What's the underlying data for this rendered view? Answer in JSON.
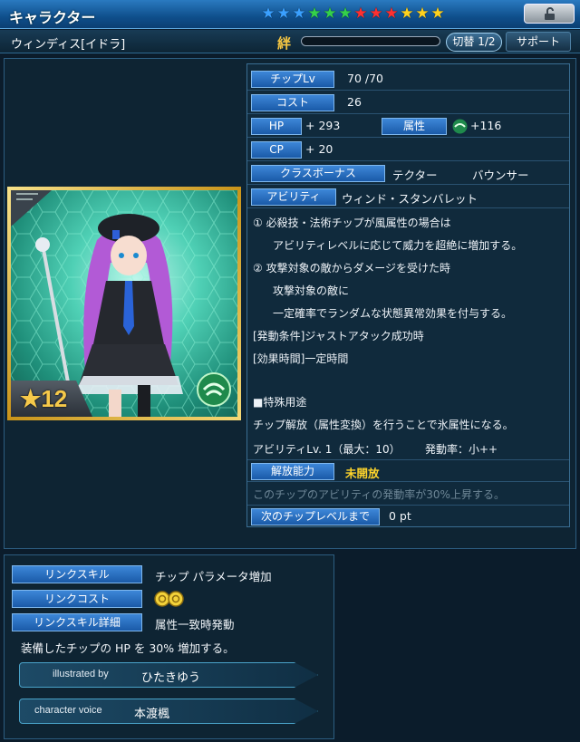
{
  "header": {
    "title": "キャラクター",
    "stars": [
      {
        "color": "#3aa0ff"
      },
      {
        "color": "#3aa0ff"
      },
      {
        "color": "#3aa0ff"
      },
      {
        "color": "#34d04a"
      },
      {
        "color": "#34d04a"
      },
      {
        "color": "#34d04a"
      },
      {
        "color": "#ff3030"
      },
      {
        "color": "#ff3030"
      },
      {
        "color": "#ff3030"
      },
      {
        "color": "#ffd21e"
      },
      {
        "color": "#ffd21e"
      },
      {
        "color": "#ffd21e"
      }
    ],
    "lock_icon": "unlock-icon"
  },
  "namebar": {
    "chip_name": "ウィンディス[イドラ]",
    "bond_label": "絆",
    "bond_progress": 0,
    "switch_label": "切替 1/2",
    "support_label": "サポート"
  },
  "stats": {
    "chip_lv_label": "チップLv",
    "chip_lv_value": "70 /70",
    "cost_label": "コスト",
    "cost_value": "26",
    "hp_label": "HP",
    "hp_value": "+ 293",
    "attribute_label": "属性",
    "attribute_value": "+116",
    "attribute_icon": "wind-element-icon",
    "cp_label": "CP",
    "cp_value": "+ 20",
    "class_bonus_label": "クラスボーナス",
    "class_bonus_1": "テクター",
    "class_bonus_2": "バウンサー",
    "ability_label": "アビリティ",
    "ability_value": "ウィンド・スタンバレット"
  },
  "ability_desc": {
    "line1": "① 必殺技・法術チップが風属性の場合は",
    "line2": "アビリティレベルに応じて威力を超絶に増加する。",
    "line3": "② 攻撃対象の敵からダメージを受けた時",
    "line4": "攻撃対象の敵に",
    "line5": "一定確率でランダムな状態異常効果を付与する。",
    "trigger": "[発動条件]ジャストアタック成功時",
    "duration": "[効果時間]一定時間",
    "special_heading": "■特殊用途",
    "special_text": "チップ解放（属性変換）を行うことで氷属性になる。",
    "ability_lv": "アビリティLv. 1（最大：10）",
    "activation_rate": "発動率：小++"
  },
  "release": {
    "label": "解放能力",
    "status": "未開放",
    "desc": "このチップのアビリティの発動率が30%上昇する。",
    "next_label": "次のチップレベルまで",
    "next_value": "0 pt"
  },
  "portrait": {
    "rarity": "12",
    "rarity_icon": "star-icon",
    "element_icon": "wind-element-icon"
  },
  "link": {
    "skill_label": "リンクスキル",
    "skill_value": "チップ パラメータ増加",
    "cost_label": "リンクコスト",
    "cost_icon": "link-cost-coin-icon",
    "detail_label": "リンクスキル詳細",
    "detail_value": "属性一致時発動",
    "detail_desc": "装備したチップの HP を 30% 増加する。"
  },
  "credits": {
    "illustrator_label": "illustrated by",
    "illustrator_name": "ひたきゆう",
    "voice_label": "character voice",
    "voice_name": "本渡楓"
  }
}
